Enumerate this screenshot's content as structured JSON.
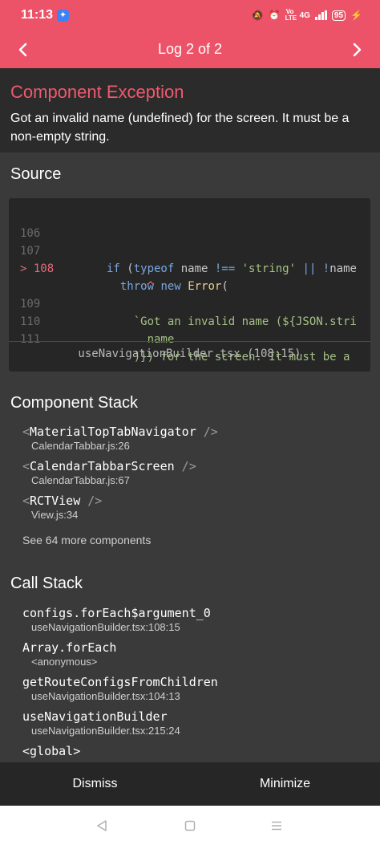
{
  "status_bar": {
    "time": "11:13",
    "network": "4G",
    "battery": "95"
  },
  "header": {
    "title": "Log 2 of 2"
  },
  "exception": {
    "title": "Component Exception",
    "message": "Got an invalid name (undefined) for the screen. It must be a non-empty string."
  },
  "source": {
    "title": "Source",
    "lines": [
      {
        "num": "106",
        "code": ""
      },
      {
        "num": "107",
        "code": "if (typeof name !== 'string' || !name"
      },
      {
        "num": "> 108",
        "code": "  throw new Error("
      },
      {
        "num": "",
        "code": "      ^"
      },
      {
        "num": "109",
        "code": "    `Got an invalid name (${JSON.stri"
      },
      {
        "num": "110",
        "code": "      name"
      },
      {
        "num": "111",
        "code": "    )}) for the screen. It must be a"
      }
    ],
    "file": "useNavigationBuilder.tsx (108:15)"
  },
  "component_stack": {
    "title": "Component Stack",
    "items": [
      {
        "name": "MaterialTopTabNavigator",
        "location": "CalendarTabbar.js:26"
      },
      {
        "name": "CalendarTabbarScreen",
        "location": "CalendarTabbar.js:67"
      },
      {
        "name": "RCTView",
        "location": "View.js:34"
      }
    ],
    "open_bracket": "<",
    "close_bracket": " />",
    "close_bracket_alt": " />",
    "see_more": "See 64 more components"
  },
  "call_stack": {
    "title": "Call Stack",
    "items": [
      {
        "name": "configs.forEach$argument_0",
        "location": "useNavigationBuilder.tsx:108:15"
      },
      {
        "name": "Array.forEach",
        "location": "<anonymous>"
      },
      {
        "name": "getRouteConfigsFromChildren",
        "location": "useNavigationBuilder.tsx:104:13"
      },
      {
        "name": "useNavigationBuilder",
        "location": "useNavigationBuilder.tsx:215:24"
      },
      {
        "name": "<global>",
        "location": ""
      }
    ]
  },
  "footer": {
    "dismiss": "Dismiss",
    "minimize": "Minimize"
  },
  "colors": {
    "accent": "#ec5368",
    "error_title": "#f0596e",
    "keyword": "#7aa7e0",
    "string": "#a5c184"
  },
  "icons": {
    "prev": "chevron-left-icon",
    "next": "chevron-right-icon",
    "back": "triangle-back-icon",
    "home": "square-home-icon",
    "recents": "menu-recents-icon"
  }
}
